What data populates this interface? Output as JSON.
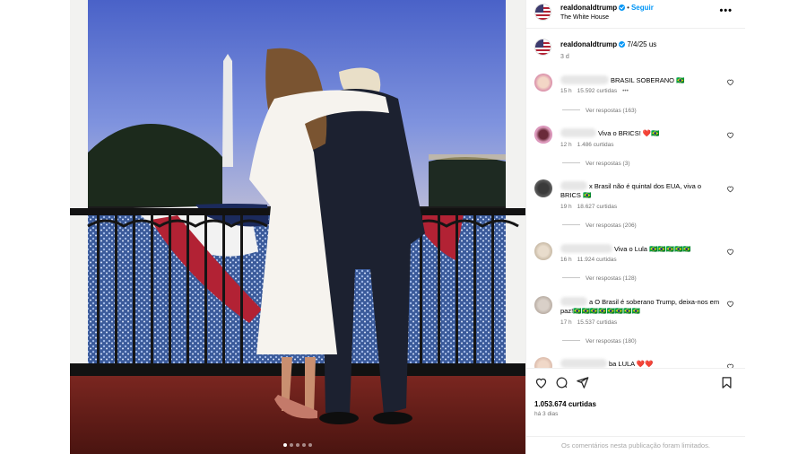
{
  "post": {
    "username": "realdonaldtrump",
    "separator": "•",
    "follow_label": "Seguir",
    "location": "The White House",
    "more_icon": "more-options-icon",
    "carousel": {
      "count": 5,
      "active_index": 0
    }
  },
  "caption": {
    "username": "realdonaldtrump",
    "text": "7/4/25 us",
    "time": "3 d"
  },
  "comments": [
    {
      "text": "BRASIL SOBERANO 🇧🇷",
      "time": "15 h",
      "likes": "15.592 curtidas",
      "has_more": true,
      "more_label": "•••",
      "replies": "Ver respostas (163)"
    },
    {
      "text": "Viva o BRICS! ❤️🇧🇷",
      "time": "12 h",
      "likes": "1.486 curtidas",
      "replies": "Ver respostas (3)"
    },
    {
      "text": "x Brasil não é quintal dos EUA, viva o BRICS 🇧🇷",
      "time": "19 h",
      "likes": "18.627 curtidas",
      "replies": "Ver respostas (206)"
    },
    {
      "text": "Viva o Lula 🇧🇷🇧🇷🇧🇷🇧🇷🇧🇷",
      "time": "16 h",
      "likes": "11.924 curtidas",
      "replies": "Ver respostas (128)"
    },
    {
      "text": "a O Brasil é soberano Trump, deixa-nos em paz!🇧🇷🇧🇷🇧🇷🇧🇷🇧🇷🇧🇷🇧🇷🇧🇷",
      "time": "17 h",
      "likes": "15.537 curtidas",
      "replies": "Ver respostas (180)"
    },
    {
      "text": "ba LULA ❤️❤️"
    }
  ],
  "actions": {
    "likes": "1.053.674 curtidas",
    "ago": "há 3 dias",
    "limited_notice": "Os comentários nesta publicação foram limitados."
  },
  "colors": {
    "accent": "#0095f6",
    "muted": "#737373",
    "heart": "#ed4956"
  }
}
